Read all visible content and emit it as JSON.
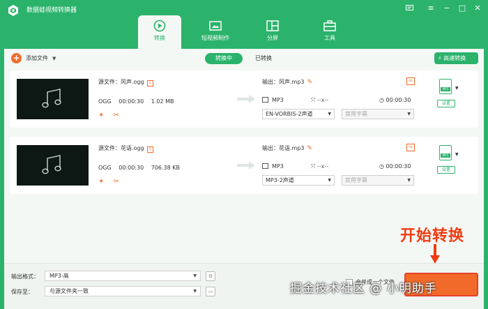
{
  "app": {
    "title": "数据蛙视频转换器"
  },
  "nav_tabs": [
    {
      "label": "转换",
      "icon": "convert-icon"
    },
    {
      "label": "短视频制作",
      "icon": "video-maker-icon"
    },
    {
      "label": "分屏",
      "icon": "split-screen-icon"
    },
    {
      "label": "工具",
      "icon": "toolbox-icon"
    }
  ],
  "toolbar": {
    "add_file": "添加文件",
    "seg_converting": "转换中",
    "seg_converted": "已转换",
    "high_speed": "高速转换"
  },
  "files": [
    {
      "source": "源文件：风声.ogg",
      "format": "OGG",
      "duration": "00:00:30",
      "size": "1.02 MB",
      "output": "输出：风声.mp3",
      "out_format": "MP3",
      "out_res": "--x--",
      "out_duration": "00:00:30",
      "audio_track": "EN-VORBIS-2声道",
      "subtitle": "禁用字幕",
      "settings": "设置"
    },
    {
      "source": "源文件：花语.ogg",
      "format": "OGG",
      "duration": "00:00:30",
      "size": "706.38 KB",
      "output": "输出：花语.mp3",
      "out_format": "MP3",
      "out_res": "--x--",
      "out_duration": "00:00:30",
      "audio_track": "MP3-2声道",
      "subtitle": "禁用字幕",
      "settings": "设置"
    }
  ],
  "bottom": {
    "out_format_label": "输出格式：",
    "out_format_value": "MP3-高",
    "save_to_label": "保存至：",
    "save_to_value": "与源文件夹一致",
    "merge_label": "合并成一个文件"
  },
  "annotation": {
    "title": "开始转换",
    "watermark": "掘金技术社区 @ 小明助手"
  },
  "colors": {
    "brand_green": "#2bb36b",
    "accent_orange": "#f26a2a",
    "annotation_red": "#f23b12"
  }
}
